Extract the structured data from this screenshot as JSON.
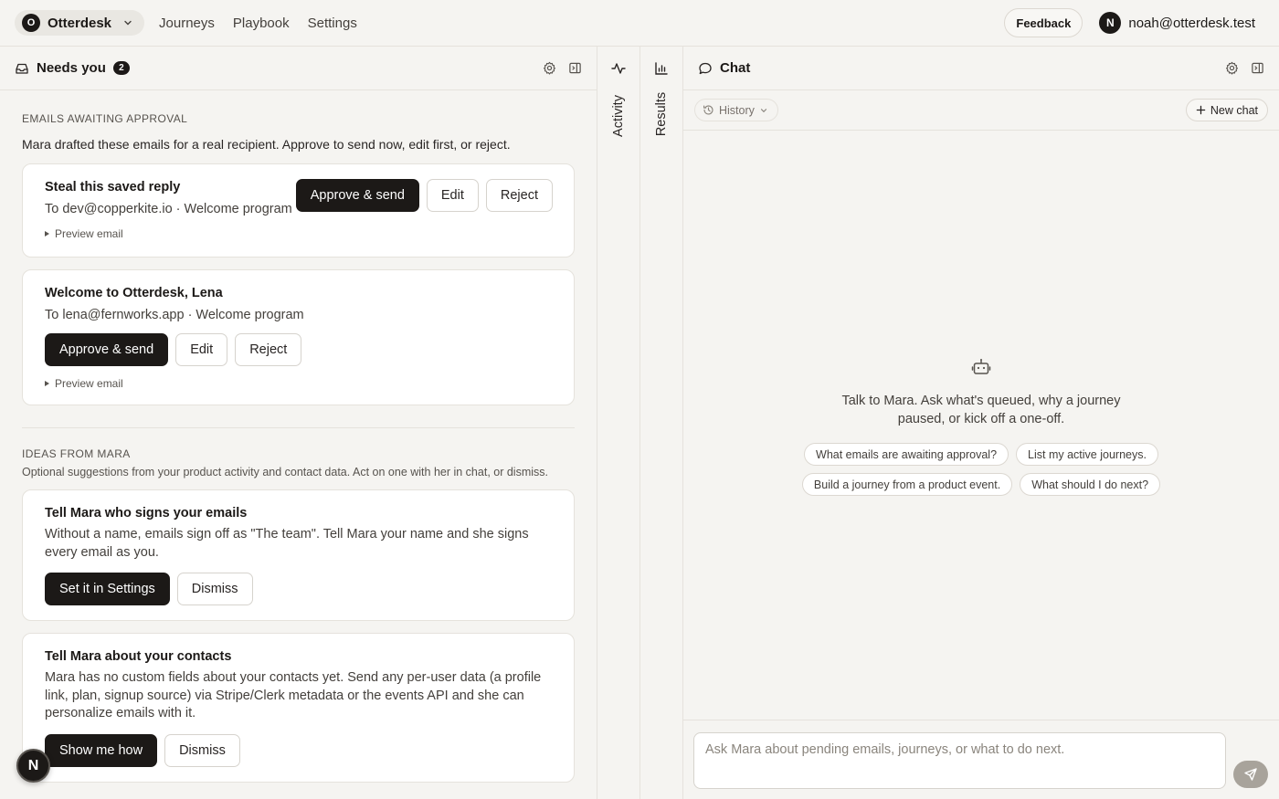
{
  "topbar": {
    "workspace_initial": "O",
    "workspace_name": "Otterdesk",
    "nav": [
      "Journeys",
      "Playbook",
      "Settings"
    ],
    "feedback_label": "Feedback",
    "user_initial": "N",
    "user_email": "noah@otterdesk.test"
  },
  "needs_you": {
    "title": "Needs you",
    "count": "2",
    "approval_label": "EMAILS AWAITING APPROVAL",
    "approval_desc": "Mara drafted these emails for a real recipient. Approve to send now, edit first, or reject.",
    "emails": [
      {
        "subject": "Steal this saved reply",
        "meta": "To dev@copperkite.io · Welcome program",
        "approve": "Approve & send",
        "edit": "Edit",
        "reject": "Reject",
        "preview": "Preview email"
      },
      {
        "subject": "Welcome to Otterdesk, Lena",
        "meta": "To lena@fernworks.app · Welcome program",
        "approve": "Approve & send",
        "edit": "Edit",
        "reject": "Reject",
        "preview": "Preview email"
      }
    ],
    "ideas_label": "IDEAS FROM MARA",
    "ideas_desc": "Optional suggestions from your product activity and contact data. Act on one with her in chat, or dismiss.",
    "ideas": [
      {
        "title": "Tell Mara who signs your emails",
        "text": "Without a name, emails sign off as \"The team\". Tell Mara your name and she signs every email as you.",
        "action": "Set it in Settings",
        "dismiss": "Dismiss"
      },
      {
        "title": "Tell Mara about your contacts",
        "text": "Mara has no custom fields about your contacts yet. Send any per-user data (a profile link, plan, signup source) via Stripe/Clerk metadata or the events API and she can personalize emails with it.",
        "action": "Show me how",
        "dismiss": "Dismiss"
      }
    ]
  },
  "rails": {
    "activity": "Activity",
    "results": "Results"
  },
  "chat": {
    "title": "Chat",
    "history_label": "History",
    "new_chat_label": "New chat",
    "empty_text": "Talk to Mara. Ask what's queued, why a journey paused, or kick off a one-off.",
    "suggestions": [
      "What emails are awaiting approval?",
      "List my active journeys.",
      "Build a journey from a product event.",
      "What should I do next?"
    ],
    "input_placeholder": "Ask Mara about pending emails, journeys, or what to do next."
  },
  "floating_avatar_initial": "N",
  "colors": {
    "background": "#f5f4f1",
    "primary_button": "#1c1917",
    "border": "#e5e2dc",
    "send_button_disabled": "#a8a39b"
  },
  "icons": [
    "chevron-down-icon",
    "inbox-icon",
    "gear-icon",
    "panel-collapse-icon",
    "activity-icon",
    "bar-chart-icon",
    "chat-bubble-icon",
    "history-icon",
    "plus-icon",
    "robot-icon",
    "send-icon"
  ]
}
